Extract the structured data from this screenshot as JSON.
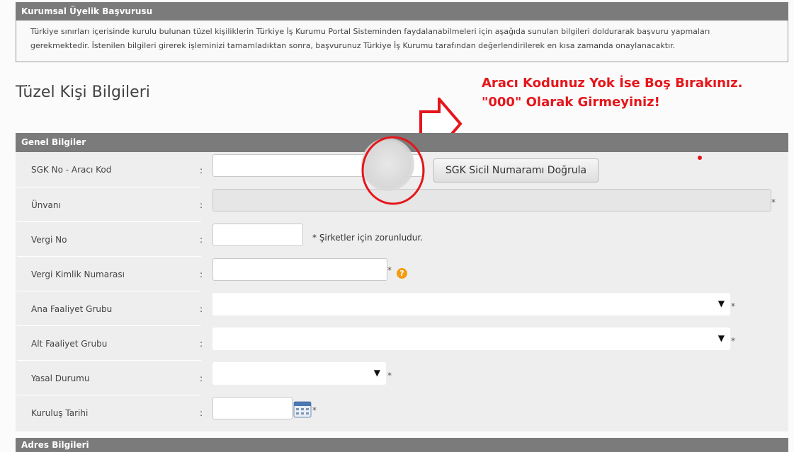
{
  "intro": {
    "heading": "Kurumsal Üyelik Başvurusu",
    "line1": "Türkiye sınırları içerisinde kurulu bulunan tüzel kişiliklerin Türkiye İş Kurumu Portal Sisteminden faydalanabilmeleri için aşağıda sunulan bilgileri doldurarak başvuru yapmaları",
    "line2": "gerekmektedir. İstenilen bilgileri girerek işleminizi tamamladıktan sonra, başvurunuz Türkiye İş Kurumu tarafından değerlendirilerek en kısa zamanda onaylanacaktır."
  },
  "page_title": "Tüzel Kişi Bilgileri",
  "annotation": {
    "line1": "Aracı Kodunuz Yok İse Boş Bırakınız.",
    "line2": "\"000\" Olarak Girmeyiniz!",
    "color": "#e5161b"
  },
  "general": {
    "heading": "Genel Bilgiler",
    "sgk_label": "SGK No - Aracı Kod",
    "sgk_button": "SGK Sicil Numaramı Doğrula",
    "unvan_label": "Ünvanı",
    "vergi_no_label": "Vergi No",
    "vergi_no_hint": "* Şirketler için zorunludur.",
    "vkn_label": "Vergi Kimlik Numarası",
    "ana_label": "Ana Faaliyet Grubu",
    "alt_label": "Alt Faaliyet Grubu",
    "yasal_label": "Yasal Durumu",
    "kurulus_label": "Kuruluş Tarihi",
    "colon": ":",
    "required": "*",
    "help": "?"
  },
  "address": {
    "heading": "Adres Bilgileri"
  },
  "colors": {
    "header_bg": "#7b7b7b",
    "form_bg": "#eeeeee",
    "help_icon": "#f39c12"
  }
}
